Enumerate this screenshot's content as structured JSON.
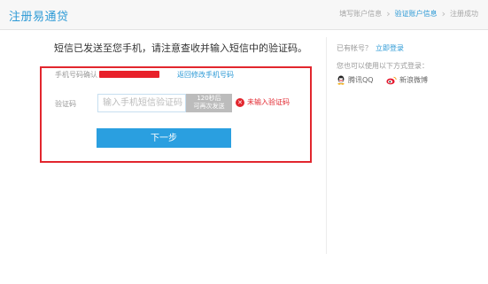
{
  "header": {
    "brand": "注册易通贷",
    "steps": [
      {
        "label": "填写账户信息",
        "active": false
      },
      {
        "label": "验证账户信息",
        "active": true
      },
      {
        "label": "注册成功",
        "active": false
      }
    ]
  },
  "main": {
    "notice": "短信已发送至您手机，请注意查收并输入短信中的验证码。",
    "phone_label": "手机号码确认",
    "change_phone_link": "返回修改手机号码",
    "code_label": "验证码",
    "code_placeholder": "输入手机短信验证码",
    "code_value": "",
    "resend_line1": "120秒后",
    "resend_line2": "可再次发送",
    "error_text": "未输入验证码",
    "next_button": "下一步"
  },
  "side": {
    "have_account": "已有帐号？",
    "login_link": "立即登录",
    "also_use": "您也可以使用以下方式登录：",
    "social": [
      {
        "label": "腾讯QQ",
        "icon": "qq-icon"
      },
      {
        "label": "新浪微博",
        "icon": "weibo-icon"
      }
    ]
  },
  "colors": {
    "accent": "#2d9ad6",
    "button": "#2a9fe0",
    "error": "#e2262e",
    "disabled": "#bcbcbc"
  }
}
